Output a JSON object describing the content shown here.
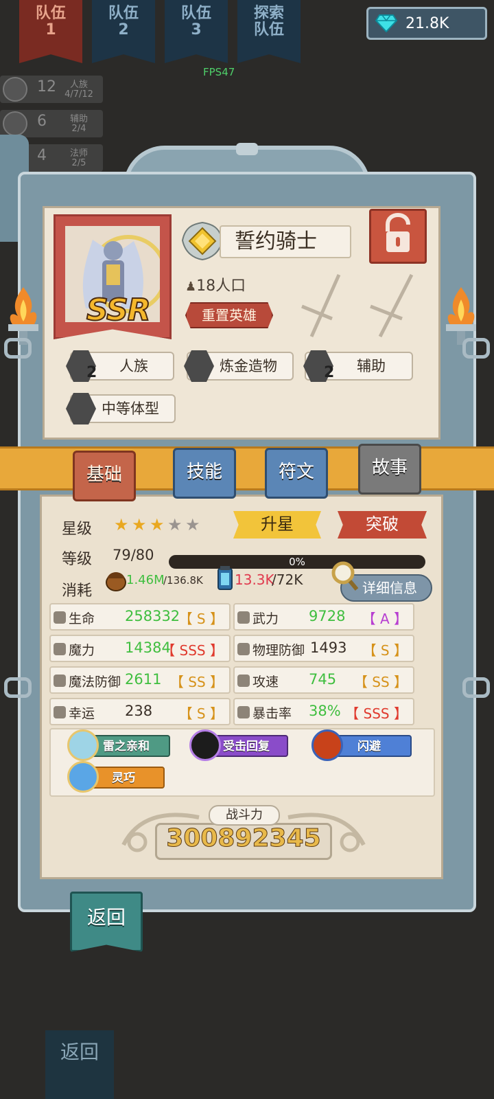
{
  "top_tabs": [
    {
      "line1": "队伍",
      "line2": "1"
    },
    {
      "line1": "队伍",
      "line2": "2"
    },
    {
      "line1": "队伍",
      "line2": "3"
    },
    {
      "line1": "探索",
      "line2": "队伍"
    }
  ],
  "currency": {
    "value": "21.8K",
    "icon": "diamond-icon"
  },
  "fps": "FPS47",
  "race_rows": [
    {
      "num": "12",
      "name": "人族",
      "count": "4/7/12"
    },
    {
      "num": "6",
      "name": "辅助",
      "count": "2/4"
    },
    {
      "num": "4",
      "name": "法师",
      "count": "2/5"
    }
  ],
  "hero": {
    "rarity": "SSR",
    "name": "誓约骑士",
    "population": "18人口",
    "reset_label": "重置英雄"
  },
  "traits": [
    {
      "label": "人族",
      "count": "2",
      "icon": "human-icon"
    },
    {
      "label": "炼金造物",
      "count": "",
      "icon": "flask-icon"
    },
    {
      "label": "辅助",
      "count": "2",
      "icon": "cross-icon"
    },
    {
      "label": "中等体型",
      "count": "",
      "icon": "body-icon"
    }
  ],
  "tabs": [
    "基础",
    "技能",
    "符文",
    "故事"
  ],
  "basics": {
    "star_label": "星级",
    "stars_filled": 3,
    "stars_total": 5,
    "upstar_label": "升星",
    "breakthrough_label": "突破",
    "level_label": "等级",
    "level_value": "79/80",
    "progress_text": "0%",
    "progress": 0,
    "cost_label": "消耗",
    "cost1_have": "1.46M",
    "cost1_need": "/136.8K",
    "cost2_have": "13.3K",
    "cost2_need": "/72K",
    "detail_label": "详细信息"
  },
  "stats": [
    {
      "name": "生命",
      "value": "258332",
      "grade": "【 S 】",
      "value_color": "#3fbe3f",
      "grade_color": "#d6921a"
    },
    {
      "name": "武力",
      "value": "9728",
      "grade": "【 A 】",
      "value_color": "#3fbe3f",
      "grade_color": "#b73fd1"
    },
    {
      "name": "魔力",
      "value": "14384",
      "grade": "【 SSS 】",
      "value_color": "#3fbe3f",
      "grade_color": "#e03a2e"
    },
    {
      "name": "物理防御",
      "value": "1493",
      "grade": "【 S 】",
      "value_color": "#3a3028",
      "grade_color": "#d6921a"
    },
    {
      "name": "魔法防御",
      "value": "2611",
      "grade": "【 SS 】",
      "value_color": "#3fbe3f",
      "grade_color": "#d6921a"
    },
    {
      "name": "攻速",
      "value": "745",
      "grade": "【 SS 】",
      "value_color": "#3fbe3f",
      "grade_color": "#d6921a"
    },
    {
      "name": "幸运",
      "value": "238",
      "grade": "【 S 】",
      "value_color": "#3a3028",
      "grade_color": "#d6921a"
    },
    {
      "name": "暴击率",
      "value": "38%",
      "grade": "【 SSS 】",
      "value_color": "#3fbe3f",
      "grade_color": "#e03a2e"
    }
  ],
  "skills": [
    {
      "label": "雷之亲和",
      "color": "#4f9a84"
    },
    {
      "label": "受击回复",
      "color": "#8a4cc9"
    },
    {
      "label": "闪避",
      "color": "#4f80d6"
    },
    {
      "label": "灵巧",
      "color": "#e8922a"
    }
  ],
  "power": {
    "label": "战斗力",
    "value": "300892345"
  },
  "back_label": "返回",
  "back_label_bg": "返回"
}
